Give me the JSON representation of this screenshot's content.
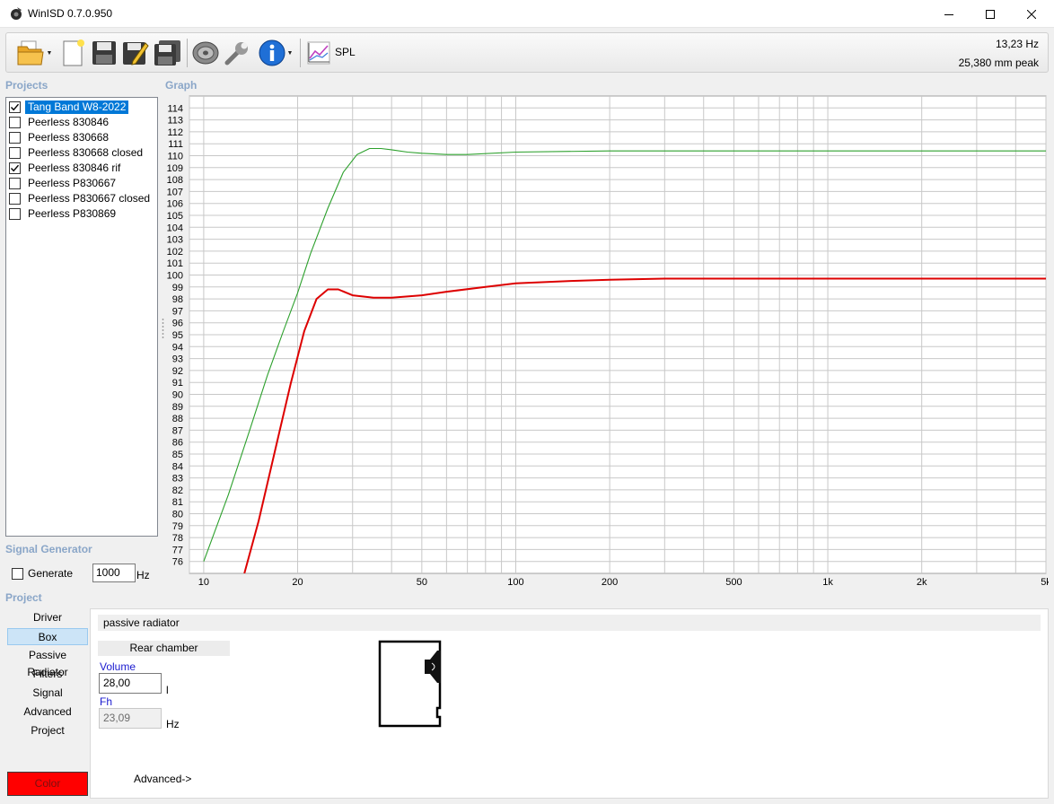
{
  "window": {
    "title": "WinISD 0.7.0.950",
    "controls": [
      "minimize",
      "maximize",
      "close"
    ]
  },
  "toolbar": {
    "spl_label": "SPL",
    "readout_freq": "13,23 Hz",
    "readout_excursion": "25,380 mm peak"
  },
  "sections": {
    "projects": "Projects",
    "graph": "Graph",
    "signal_generator": "Signal Generator",
    "project": "Project"
  },
  "projects": [
    {
      "name": "Tang Band W8-2022",
      "checked": true,
      "selected": true
    },
    {
      "name": "Peerless 830846",
      "checked": false,
      "selected": false
    },
    {
      "name": "Peerless 830668",
      "checked": false,
      "selected": false
    },
    {
      "name": "Peerless 830668 closed",
      "checked": false,
      "selected": false
    },
    {
      "name": "Peerless 830846 rif",
      "checked": true,
      "selected": false
    },
    {
      "name": "Peerless P830667",
      "checked": false,
      "selected": false
    },
    {
      "name": "Peerless P830667 closed",
      "checked": false,
      "selected": false
    },
    {
      "name": "Peerless P830869",
      "checked": false,
      "selected": false
    }
  ],
  "signal_generator": {
    "generate_label": "Generate",
    "generate_checked": false,
    "frequency_value": "1000",
    "frequency_unit": "Hz"
  },
  "project_nav": {
    "items": [
      "Driver",
      "Box",
      "Passive Radiator",
      "Filters",
      "Signal",
      "Advanced",
      "Project"
    ],
    "active": "Box",
    "color_button": "Color",
    "color_value": "#ff0000"
  },
  "box_panel": {
    "type": "passive radiator",
    "rear_chamber": "Rear chamber",
    "volume_label": "Volume",
    "volume_value": "28,00",
    "volume_unit": "l",
    "fh_label": "Fh",
    "fh_value": "23,09",
    "fh_unit": "Hz",
    "advanced_link": "Advanced->"
  },
  "chart_data": {
    "type": "line",
    "title": "",
    "xlabel": "",
    "ylabel": "",
    "x_scale": "log",
    "xlim": [
      9,
      5000
    ],
    "ylim": [
      75,
      115
    ],
    "x_ticks": [
      {
        "value": 10,
        "label": "10"
      },
      {
        "value": 20,
        "label": "20"
      },
      {
        "value": 50,
        "label": "50"
      },
      {
        "value": 100,
        "label": "100"
      },
      {
        "value": 200,
        "label": "200"
      },
      {
        "value": 500,
        "label": "500"
      },
      {
        "value": 1000,
        "label": "1k"
      },
      {
        "value": 2000,
        "label": "2k"
      },
      {
        "value": 5000,
        "label": "5k"
      }
    ],
    "y_ticks": [
      76,
      77,
      78,
      79,
      80,
      81,
      82,
      83,
      84,
      85,
      86,
      87,
      88,
      89,
      90,
      91,
      92,
      93,
      94,
      95,
      96,
      97,
      98,
      99,
      100,
      101,
      102,
      103,
      104,
      105,
      106,
      107,
      108,
      109,
      110,
      111,
      112,
      113,
      114
    ],
    "grid": true,
    "legend": "none",
    "series": [
      {
        "color": "#2ca02c",
        "x": [
          10,
          12,
          14,
          16,
          18,
          20,
          22,
          25,
          28,
          31,
          34,
          37,
          40,
          45,
          50,
          60,
          70,
          100,
          200,
          300,
          500,
          1000,
          2000,
          5000
        ],
        "y": [
          76.0,
          81.6,
          86.9,
          91.6,
          95.3,
          98.5,
          101.8,
          105.6,
          108.6,
          110.1,
          110.6,
          110.6,
          110.5,
          110.3,
          110.2,
          110.1,
          110.1,
          110.3,
          110.4,
          110.4,
          110.4,
          110.4,
          110.4,
          110.4
        ]
      },
      {
        "color": "#dd0000",
        "x": [
          13.5,
          15,
          17,
          19,
          21,
          23,
          25,
          27,
          30,
          35,
          40,
          50,
          60,
          80,
          100,
          150,
          200,
          300,
          500,
          1000,
          2000,
          5000
        ],
        "y": [
          75.0,
          79.4,
          85.5,
          90.9,
          95.3,
          98.0,
          98.8,
          98.8,
          98.3,
          98.1,
          98.1,
          98.3,
          98.6,
          99.0,
          99.3,
          99.5,
          99.6,
          99.7,
          99.7,
          99.7,
          99.7,
          99.7
        ]
      }
    ]
  }
}
